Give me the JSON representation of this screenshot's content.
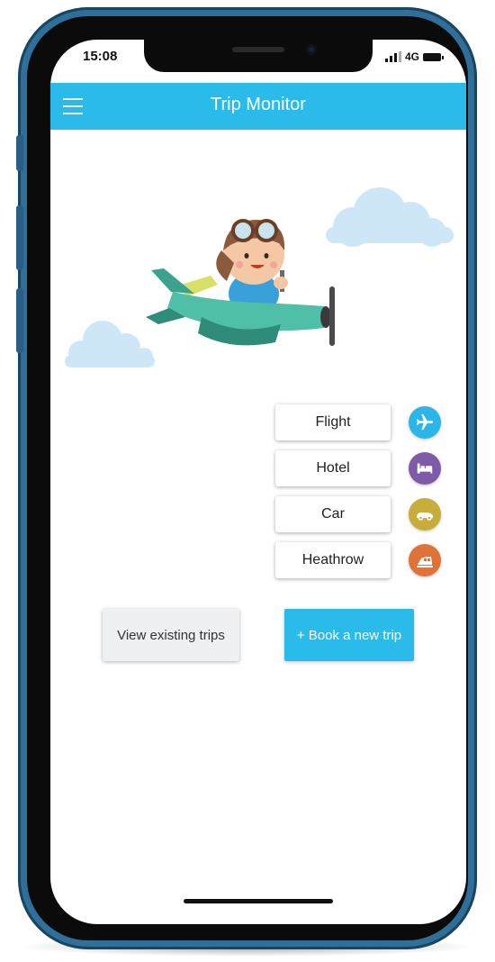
{
  "status": {
    "time": "15:08",
    "network": "4G"
  },
  "header": {
    "title": "Trip Monitor"
  },
  "options": [
    {
      "label": "Flight",
      "icon": "airplane-icon",
      "color": "#2bb5e8"
    },
    {
      "label": "Hotel",
      "icon": "bed-icon",
      "color": "#7f5aa8"
    },
    {
      "label": "Car",
      "icon": "car-icon",
      "color": "#c7ad3a"
    },
    {
      "label": "Heathrow",
      "icon": "train-icon",
      "color": "#e0733a"
    }
  ],
  "actions": {
    "view_label": "View existing trips",
    "book_label": "+ Book a new trip"
  },
  "colors": {
    "accent": "#2bbbea",
    "frame": "#2f6f9a"
  }
}
